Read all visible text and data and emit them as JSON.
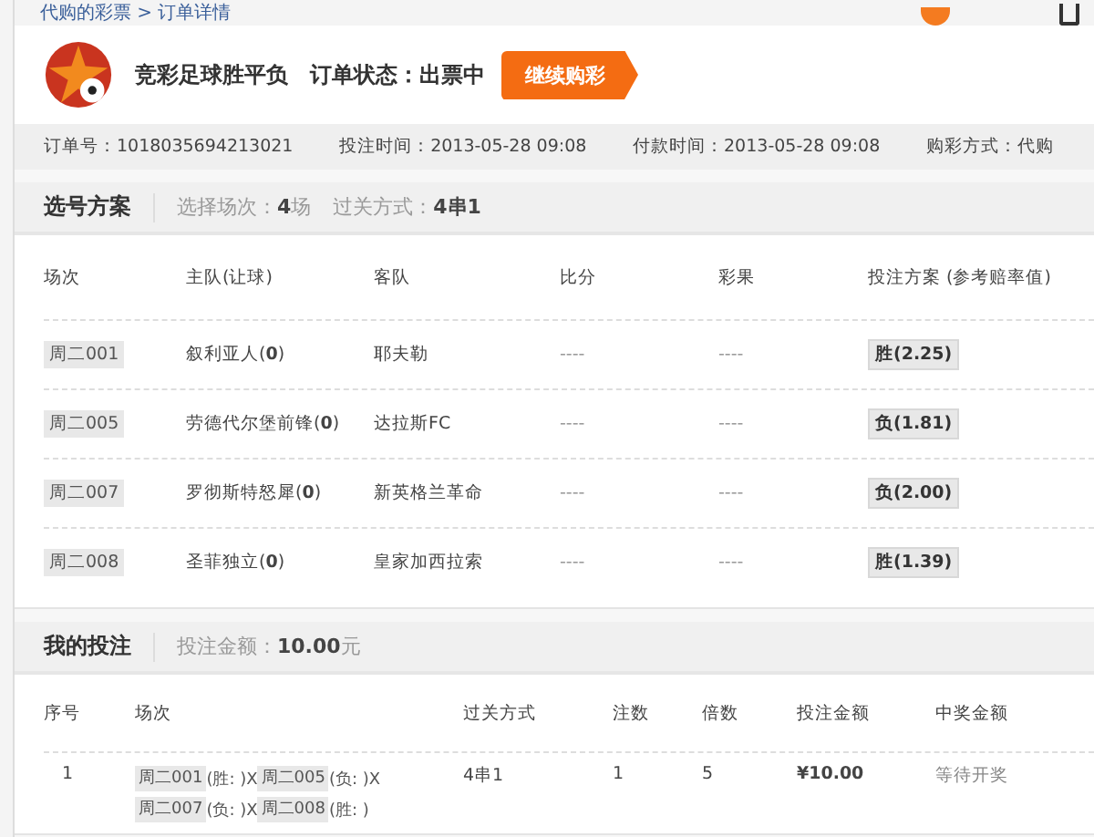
{
  "breadcrumb": "代购的彩票 > 订单详情",
  "header": {
    "title": "竞彩足球胜平负",
    "status_label": "订单状态：",
    "status_value": "出票中",
    "button": "继续购彩"
  },
  "order_info": [
    {
      "label": "订单号：",
      "value": "1018035694213021"
    },
    {
      "label": "投注时间：",
      "value": "2013-05-28 09:08"
    },
    {
      "label": "付款时间：",
      "value": "2013-05-28 09:08"
    },
    {
      "label": "购彩方式：",
      "value": "代购"
    }
  ],
  "selection": {
    "title": "选号方案",
    "summary": [
      {
        "label": "选择场次：",
        "value": "**4**场"
      },
      {
        "label": "过关方式：",
        "value": "**4串1**"
      }
    ],
    "columns": [
      "场次",
      "主队(让球)",
      "客队",
      "比分",
      "彩果",
      "投注方案 (参考赔率值)"
    ],
    "rows": [
      {
        "match": "周二001",
        "home": "叙利亚人(**0**)",
        "away": "耶夫勒",
        "score": "----",
        "result": "----",
        "bet": "胜(2.25)"
      },
      {
        "match": "周二005",
        "home": "劳德代尔堡前锋(**0**)",
        "away": "达拉斯FC",
        "score": "----",
        "result": "----",
        "bet": "负(1.81)"
      },
      {
        "match": "周二007",
        "home": "罗彻斯特怒犀(**0**)",
        "away": "新英格兰革命",
        "score": "----",
        "result": "----",
        "bet": "负(2.00)"
      },
      {
        "match": "周二008",
        "home": "圣菲独立(**0**)",
        "away": "皇家加西拉索",
        "score": "----",
        "result": "----",
        "bet": "胜(1.39)"
      }
    ]
  },
  "my_bets": {
    "title": "我的投注",
    "summary": [
      {
        "label": "投注金额：",
        "value": "**10.00**元"
      }
    ],
    "columns": [
      "序号",
      "场次",
      "过关方式",
      "注数",
      "倍数",
      "投注金额",
      "中奖金额"
    ],
    "rows": [
      {
        "index": "1",
        "matches": [
          {
            "match": "周二001",
            "pick": "(胜: )X"
          },
          {
            "match": "周二005",
            "pick": "(负: )X"
          },
          {
            "match": "周二007",
            "pick": "(负: )X"
          },
          {
            "match": "周二008",
            "pick": "(胜: )"
          }
        ],
        "pass_type": "4串1",
        "count": "1",
        "multiple": "5",
        "amount": "¥10.00",
        "prize": "等待开奖"
      }
    ]
  }
}
